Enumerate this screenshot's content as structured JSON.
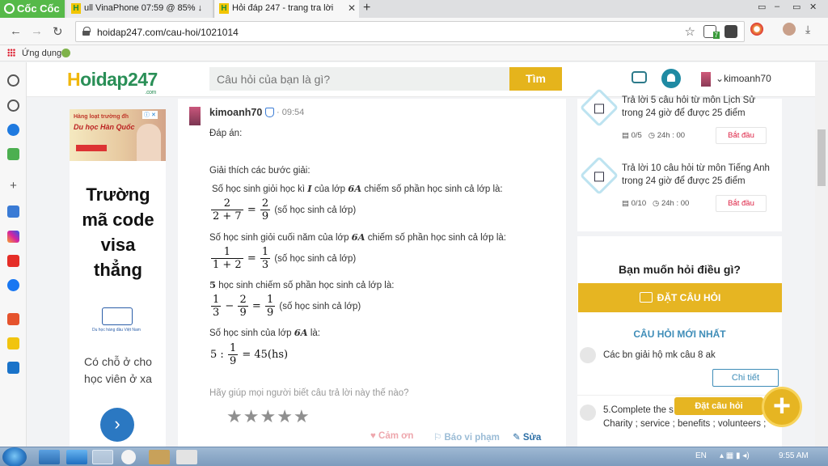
{
  "browser": {
    "brand": "Cốc Cốc",
    "tabs": [
      {
        "title": "ull VinaPhone 07:59 @ 85% ↓"
      },
      {
        "title": "Hỏi đáp 247 - trang tra lời"
      }
    ],
    "url": "hoidap247.com/cau-hoi/1021014",
    "bookmarks_label": "Ứng dụng",
    "ext_badge": "7"
  },
  "site": {
    "logo_main": "oidap247",
    "logo_h": "H",
    "logo_suffix": ".com",
    "search_placeholder": "Câu hỏi của bạn là gì?",
    "search_button": "Tìm",
    "username": "kimoanh70"
  },
  "ad": {
    "tag": "ⓘ ✕",
    "head": "Hàng loạt trường đh",
    "sub": "Du học Hàn Quốc",
    "headline": "Trường mã code visa thẳng",
    "body": "Có chỗ ở cho học viên ở xa",
    "shield_caption": "Du học hàng đầu Việt Nam"
  },
  "answer": {
    "author": "kimoanh70",
    "time": "· 09:54",
    "lines": {
      "answer_label": "Đáp án:",
      "explain_label": "Giải thích các bước giải:",
      "l1_pre": "Số học sinh giỏi học kì ",
      "l1_roman": "I",
      "l1_mid": " của lớp ",
      "l1_class": "6A",
      "l1_post": " chiếm số phần học sinh cả lớp là:",
      "l2_pre": "Số học sinh giỏi cuối năm của lớp ",
      "l2_class": "6A",
      "l2_post": " chiếm số phần học sinh cả lớp là:",
      "l3_num": "5",
      "l3_post": " học sinh chiếm số phần học sinh cả lớp là:",
      "l4_pre": "Số học sinh của lớp ",
      "l4_class": "6A",
      "l4_post": " là:",
      "caption": "(số học sinh cả lớp)"
    },
    "eq1": {
      "n1": "2",
      "d1": "2 + 7",
      "eq": "=",
      "n2": "2",
      "d2": "9"
    },
    "eq2": {
      "n1": "1",
      "d1": "1 + 2",
      "eq": "=",
      "n2": "1",
      "d2": "3"
    },
    "eq3": {
      "n1": "1",
      "d1": "3",
      "op": "−",
      "n2": "2",
      "d2": "9",
      "eq": "=",
      "n3": "1",
      "d3": "9"
    },
    "eq4": {
      "pre": "5 :",
      "n1": "1",
      "d1": "9",
      "post": "= 45(hs)"
    },
    "rate_prompt": "Hãy giúp mọi người biết câu trả lời này thế nào?",
    "star_glyph": "★",
    "actions": {
      "thanks": "♥ Cảm ơn",
      "report": "⚐ Báo vi phạm",
      "edit": "✎ Sửa"
    }
  },
  "missions": [
    {
      "title": "Trả lời 5 câu hỏi  từ môn Lịch Sử trong 24 giờ để được 25 điểm",
      "progress": "0/5",
      "timer": "24h : 00",
      "button": "Bắt đầu"
    },
    {
      "title": "Trả lời 10 câu hỏi  từ môn Tiếng Anh trong 24 giờ để được 25 điểm",
      "progress": "0/10",
      "timer": "24h : 00",
      "button": "Bắt đầu"
    }
  ],
  "ask": {
    "title": "Bạn muốn hỏi điều gì?",
    "button": "ĐẶT CÂU HỎI",
    "newest_title": "CÂU HỎI MỚI NHẤT",
    "questions": [
      {
        "text": "Các bn giải hộ mk câu 8 ak"
      },
      {
        "text": "5.Complete the s                        wo in the box.\nCharity ;  service ; benefits ; volunteers ;"
      }
    ],
    "detail_button": "Chi tiết",
    "fab_label": "Đặt câu hỏi",
    "fab_glyph": "+"
  },
  "taskbar": {
    "lang": "EN",
    "clock": "9:55 AM"
  },
  "colors": {
    "brand_green": "#56b949",
    "accent_yellow": "#e6b522",
    "link_blue": "#3f8db8"
  }
}
